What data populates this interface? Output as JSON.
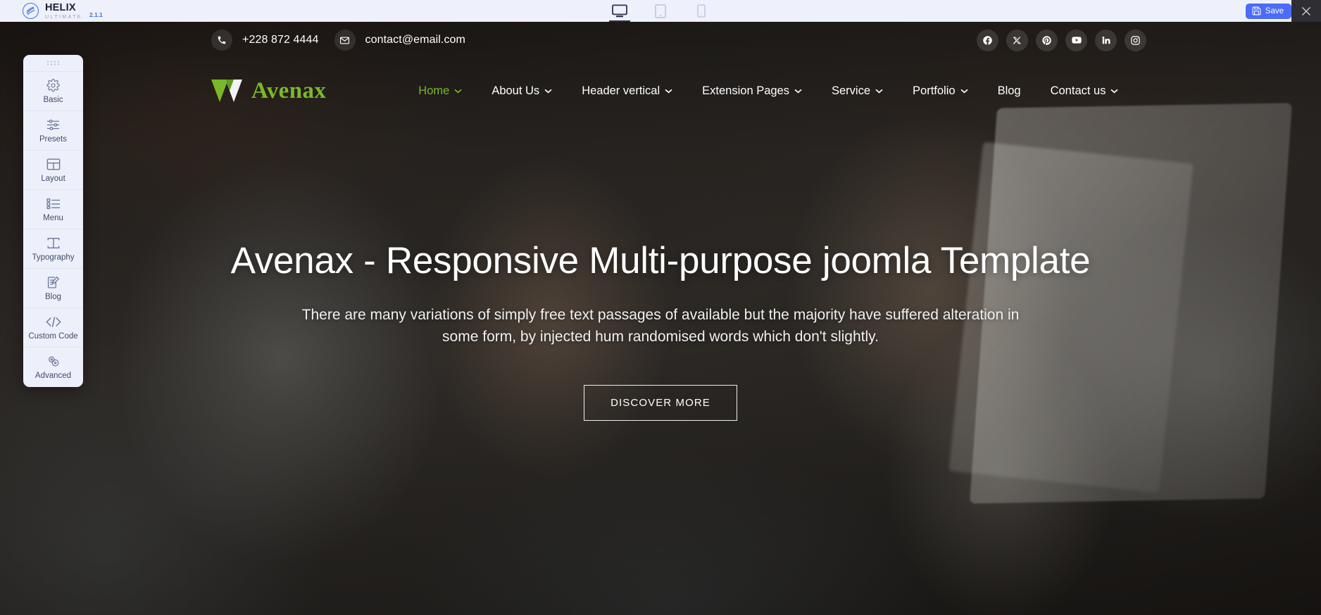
{
  "builder": {
    "brand": {
      "name": "HELIX",
      "sub": "ULTIMATE",
      "version": "2.1.1",
      "logo_icon": "helix-circle-icon"
    },
    "devices": [
      {
        "id": "desktop",
        "label": "Desktop",
        "icon": "desktop-icon",
        "active": true
      },
      {
        "id": "tablet",
        "label": "Tablet",
        "icon": "tablet-icon",
        "active": false
      },
      {
        "id": "mobile",
        "label": "Mobile",
        "icon": "mobile-icon",
        "active": false
      }
    ],
    "save_label": "Save",
    "save_icon": "floppy-disk-icon",
    "close_icon": "close-icon",
    "accent_color": "#4a6cf7",
    "bar_background": "#eef1fb"
  },
  "side_panel": {
    "drag_handle_icon": "drag-dots-icon",
    "items": [
      {
        "label": "Basic",
        "icon": "gear-icon"
      },
      {
        "label": "Presets",
        "icon": "sliders-icon"
      },
      {
        "label": "Layout",
        "icon": "layout-grid-icon"
      },
      {
        "label": "Menu",
        "icon": "menu-list-icon"
      },
      {
        "label": "Typography",
        "icon": "typography-t-icon"
      },
      {
        "label": "Blog",
        "icon": "blog-pencil-icon"
      },
      {
        "label": "Custom Code",
        "icon": "code-brackets-icon"
      },
      {
        "label": "Advanced",
        "icon": "advanced-gears-icon"
      }
    ]
  },
  "site": {
    "topbar": {
      "phone": "+228 872 4444",
      "phone_icon": "phone-icon",
      "email": "contact@email.com",
      "email_icon": "envelope-icon",
      "socials": [
        {
          "name": "facebook",
          "icon": "facebook-icon"
        },
        {
          "name": "x",
          "icon": "x-twitter-icon"
        },
        {
          "name": "pinterest",
          "icon": "pinterest-icon"
        },
        {
          "name": "youtube",
          "icon": "youtube-icon"
        },
        {
          "name": "linkedin",
          "icon": "linkedin-icon"
        },
        {
          "name": "instagram",
          "icon": "instagram-icon"
        }
      ]
    },
    "logo": {
      "text": "Avenax",
      "mark_icon": "avenax-triangle-logo",
      "color": "#7ab829"
    },
    "menu": [
      {
        "label": "Home",
        "has_dropdown": true,
        "active": true
      },
      {
        "label": "About Us",
        "has_dropdown": true,
        "active": false
      },
      {
        "label": "Header vertical",
        "has_dropdown": true,
        "active": false
      },
      {
        "label": "Extension Pages",
        "has_dropdown": true,
        "active": false
      },
      {
        "label": "Service",
        "has_dropdown": true,
        "active": false
      },
      {
        "label": "Portfolio",
        "has_dropdown": true,
        "active": false
      },
      {
        "label": "Blog",
        "has_dropdown": false,
        "active": false
      },
      {
        "label": "Contact us",
        "has_dropdown": true,
        "active": false
      }
    ],
    "hero": {
      "title": "Avenax - Responsive Multi-purpose joomla Template",
      "subtitle": "There are many variations of simply free text passages of available but the majority have suffered alteration in some form, by injected hum randomised words which don't slightly.",
      "cta_label": "DISCOVER MORE"
    }
  }
}
